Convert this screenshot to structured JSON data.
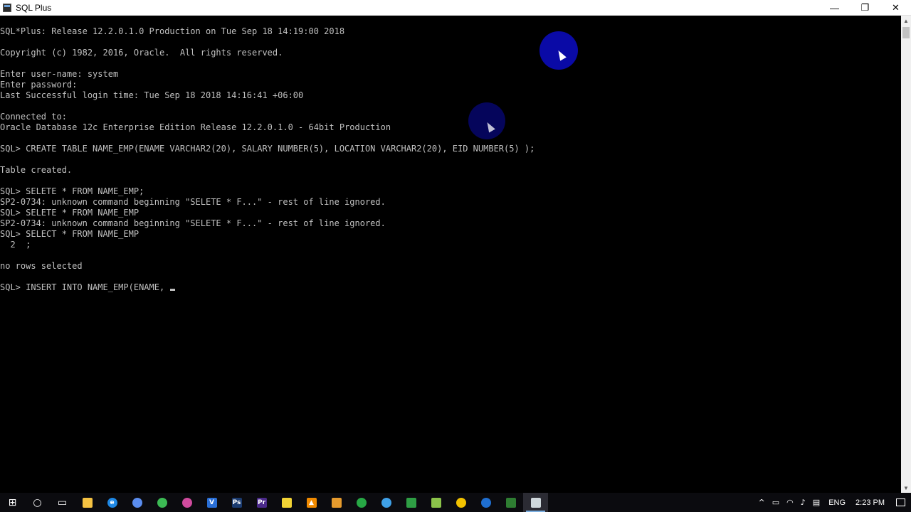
{
  "window": {
    "title": "SQL Plus",
    "controls": {
      "minimize": "—",
      "restore": "❐",
      "close": "✕"
    }
  },
  "console": {
    "lines": [
      "SQL*Plus: Release 12.2.0.1.0 Production on Tue Sep 18 14:19:00 2018",
      "",
      "Copyright (c) 1982, 2016, Oracle.  All rights reserved.",
      "",
      "Enter user-name: system",
      "Enter password:",
      "Last Successful login time: Tue Sep 18 2018 14:16:41 +06:00",
      "",
      "Connected to:",
      "Oracle Database 12c Enterprise Edition Release 12.2.0.1.0 - 64bit Production",
      "",
      "SQL> CREATE TABLE NAME_EMP(ENAME VARCHAR2(20), SALARY NUMBER(5), LOCATION VARCHAR2(20), EID NUMBER(5) );",
      "",
      "Table created.",
      "",
      "SQL> SELETE * FROM NAME_EMP;",
      "SP2-0734: unknown command beginning \"SELETE * F...\" - rest of line ignored.",
      "SQL> SELETE * FROM NAME_EMP",
      "SP2-0734: unknown command beginning \"SELETE * F...\" - rest of line ignored.",
      "SQL> SELECT * FROM NAME_EMP",
      "  2  ;",
      "",
      "no rows selected",
      ""
    ],
    "current_input": "SQL> INSERT INTO NAME_EMP(ENAME, "
  },
  "taskbar": {
    "apps": [
      {
        "icon": "windows-start-icon",
        "color": "#ffffff",
        "glyph": "⊞"
      },
      {
        "icon": "cortana-search-icon",
        "color": "#ffffff",
        "glyph": "○"
      },
      {
        "icon": "task-view-icon",
        "color": "#ffffff",
        "glyph": "▭"
      },
      {
        "icon": "file-explorer-icon",
        "color": "#f5c242",
        "glyph": ""
      },
      {
        "icon": "edge-browser-icon",
        "color": "#1e88e5",
        "glyph": "e"
      },
      {
        "icon": "app-blue-circle-icon",
        "color": "#5b8def",
        "glyph": ""
      },
      {
        "icon": "chrome-icon",
        "color": "#3cba54",
        "glyph": ""
      },
      {
        "icon": "app-magenta-circle-icon",
        "color": "#d04b9e",
        "glyph": ""
      },
      {
        "icon": "visual-studio-icon",
        "color": "#2a6fd6",
        "glyph": "V"
      },
      {
        "icon": "photoshop-icon",
        "color": "#1b3b6f",
        "glyph": "Ps"
      },
      {
        "icon": "premiere-icon",
        "color": "#4b2a8a",
        "glyph": "Pr"
      },
      {
        "icon": "notepad-pen-icon",
        "color": "#f2d335",
        "glyph": ""
      },
      {
        "icon": "vlc-icon",
        "color": "#f08a00",
        "glyph": "▲"
      },
      {
        "icon": "settings-gear-icon",
        "color": "#e59a2d",
        "glyph": ""
      },
      {
        "icon": "app-green-circle-icon",
        "color": "#27a845",
        "glyph": ""
      },
      {
        "icon": "app-lightblue-circle-icon",
        "color": "#3fa1e8",
        "glyph": ""
      },
      {
        "icon": "app-red-green-icon",
        "color": "#2e9e44",
        "glyph": ""
      },
      {
        "icon": "app-lime-square-icon",
        "color": "#8bc34a",
        "glyph": ""
      },
      {
        "icon": "app-yellow-circle-icon",
        "color": "#f2c200",
        "glyph": ""
      },
      {
        "icon": "app-blue-globe-icon",
        "color": "#1f6fd1",
        "glyph": ""
      },
      {
        "icon": "excel-like-icon",
        "color": "#2e7d32",
        "glyph": ""
      },
      {
        "icon": "sqlplus-console-icon",
        "color": "#cfd8dc",
        "glyph": ""
      }
    ],
    "tray": {
      "chevron": "^",
      "language": "ENG",
      "time": "2:23 PM"
    }
  },
  "colors": {
    "console_bg": "#000000",
    "console_text": "#c0c0c0",
    "click_highlight": "#0a0aa6"
  }
}
